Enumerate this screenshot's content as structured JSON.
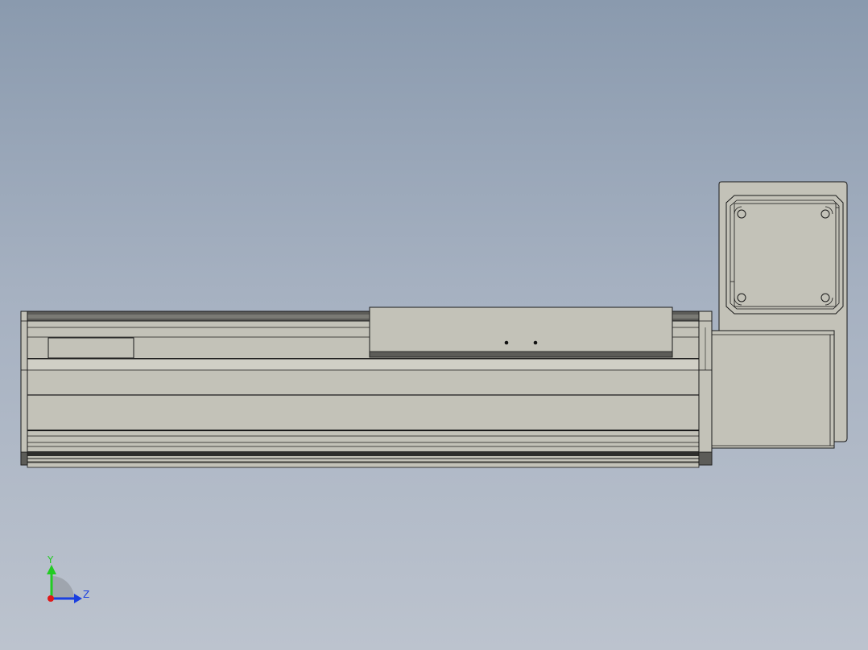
{
  "viewport": {
    "background_top": "#8a9aae",
    "background_bottom": "#bcc3ce"
  },
  "model": {
    "part_color": "#c3c2b8",
    "edge_color": "#1a1a1a",
    "dark_band_color": "#5c5c58"
  },
  "triad": {
    "y_label": "Y",
    "z_label": "Z",
    "y_color": "#22cc22",
    "z_color": "#1a3fe0",
    "x_color": "#e01818"
  }
}
